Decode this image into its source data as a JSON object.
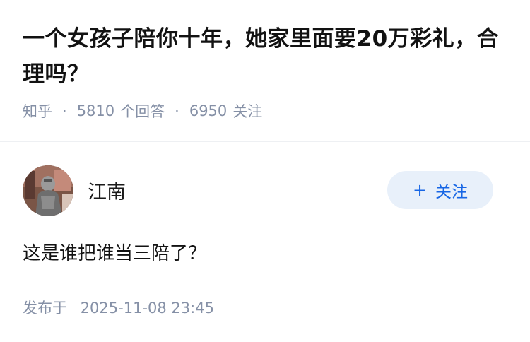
{
  "question": {
    "title": "一个女孩子陪你十年，她家里面要20万彩礼，合理吗？",
    "source": "知乎",
    "answer_count": "5810",
    "answer_label": "个回答",
    "follower_count": "6950",
    "follower_label": "关注",
    "separator": "·"
  },
  "answer": {
    "author_name": "江南",
    "follow_plus": "+",
    "follow_label": "关注",
    "content": "这是谁把谁当三陪了？",
    "published_label": "发布于",
    "published_time": "2025-11-08 23:45"
  },
  "icons": {
    "follow": "plus-icon"
  },
  "colors": {
    "accent": "#1766e5",
    "follow_bg": "#e8f0fa",
    "meta_text": "#8590a6",
    "title_text": "#121212"
  }
}
